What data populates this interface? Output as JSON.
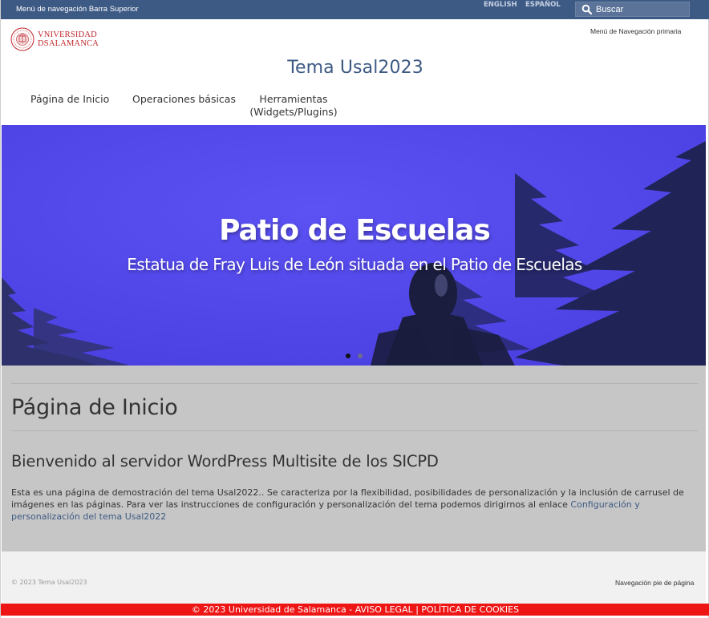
{
  "topbar": {
    "menu_label": "Menú de navegación Barra Superior",
    "lang_english": "ENGLISH",
    "lang_spanish": "ESPAÑOL",
    "search_placeholder": "Buscar",
    "background": "#3d5a84"
  },
  "header": {
    "logo_line1": "VNIVERSIDAD",
    "logo_line2": "DSALAMANCA",
    "primary_menu_label": "Menú de Navegación primaria",
    "site_title": "Tema Usal2023",
    "nav": [
      {
        "label": "Página de Inicio"
      },
      {
        "label": "Operaciones básicas"
      },
      {
        "label": "Herramientas (Widgets/Plugins)"
      }
    ]
  },
  "hero": {
    "title": "Patio de Escuelas",
    "subtitle": "Estatua de Fray Luis de León situada en el Patio de Escuelas",
    "slide_count": 2,
    "active_slide": 1
  },
  "content": {
    "page_title": "Página de Inicio",
    "heading": "Bienvenido al servidor WordPress Multisite de los SICPD",
    "paragraph": " Esta es una página de demostración del tema Usal2022.. Se caracteriza por la flexibilidad, posibilidades de personalización y la inclusión de carrusel de imágenes en las páginas. Para ver las instrucciones de configuración y personalización del tema podemos dirigirnos al enlace ",
    "link_text": "Configuración y personalización del tema Usal2022"
  },
  "footer": {
    "copyright": "© 2023 Tema Usal2023",
    "nav_label": "Navegación pie de página",
    "bottom_copyright": "© 2023 Universidad de Salamanca",
    "bottom_separator_1": " - ",
    "bottom_legal": "AVISO LEGAL",
    "bottom_separator_2": " | ",
    "bottom_cookies": "POLÍTICA DE COOKIES",
    "bottom_color": "#ee1515"
  },
  "colors": {
    "accent": "#3d5a84",
    "hero_blue": "#5548ec",
    "content_bg": "#c6c6c6",
    "footer_bg": "#f1f1f1",
    "logo_red": "#c0272d"
  }
}
